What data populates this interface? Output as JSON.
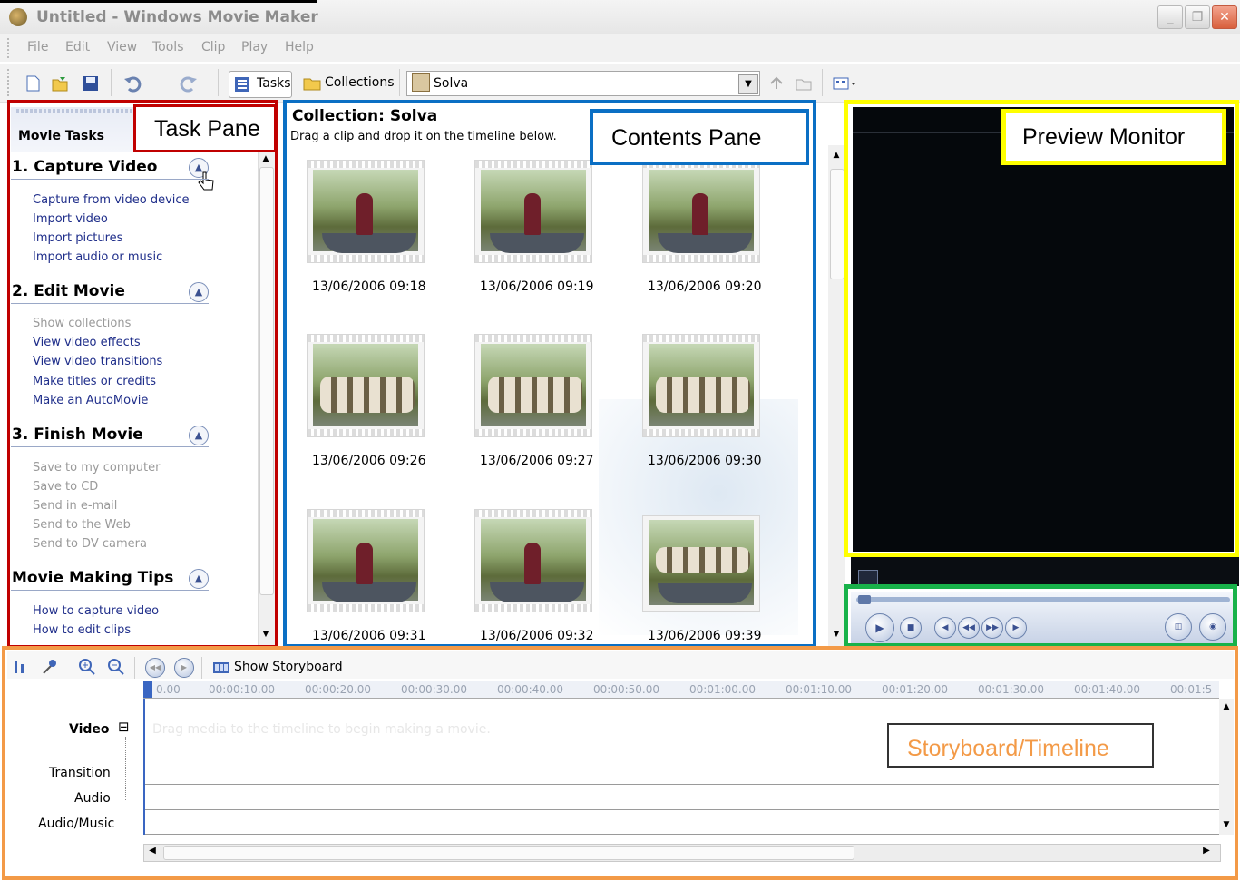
{
  "window": {
    "title": "Untitled - Windows Movie Maker",
    "minimize_glyph": "_",
    "restore_glyph": "❐",
    "close_glyph": "✕"
  },
  "menu": [
    "File",
    "Edit",
    "View",
    "Tools",
    "Clip",
    "Play",
    "Help"
  ],
  "toolbar": {
    "tasks_label": "Tasks",
    "collections_label": "Collections",
    "collection_selected": "Solva"
  },
  "annotations": {
    "task_pane": "Task Pane",
    "contents_pane": "Contents Pane",
    "preview_monitor": "Preview Monitor",
    "storyboard_timeline": "Storyboard/Timeline",
    "colors": {
      "task": "#c00000",
      "contents": "#0b6fc4",
      "preview": "#ffff00",
      "controls": "#18b24a",
      "timeline": "#f39a47"
    }
  },
  "task_pane": {
    "header": "Movie Tasks",
    "sections": [
      {
        "title": "1. Capture Video",
        "items": [
          {
            "label": "Capture from video device",
            "enabled": true
          },
          {
            "label": "Import video",
            "enabled": true
          },
          {
            "label": "Import pictures",
            "enabled": true
          },
          {
            "label": "Import audio or music",
            "enabled": true
          }
        ]
      },
      {
        "title": "2. Edit Movie",
        "items": [
          {
            "label": "Show collections",
            "enabled": false
          },
          {
            "label": "View video effects",
            "enabled": true
          },
          {
            "label": "View video transitions",
            "enabled": true
          },
          {
            "label": "Make titles or credits",
            "enabled": true
          },
          {
            "label": "Make an AutoMovie",
            "enabled": true
          }
        ]
      },
      {
        "title": "3. Finish Movie",
        "items": [
          {
            "label": "Save to my computer",
            "enabled": false
          },
          {
            "label": "Save to CD",
            "enabled": false
          },
          {
            "label": "Send in e-mail",
            "enabled": false
          },
          {
            "label": "Send to the Web",
            "enabled": false
          },
          {
            "label": "Send to DV camera",
            "enabled": false
          }
        ]
      },
      {
        "title": "Movie Making Tips",
        "items": [
          {
            "label": "How to capture video",
            "enabled": true
          },
          {
            "label": "How to edit clips",
            "enabled": true
          }
        ]
      }
    ]
  },
  "contents": {
    "title": "Collection: Solva",
    "hint": "Drag a clip and drop it on the timeline below.",
    "clips": [
      {
        "date": "13/06/2006 09:18",
        "scene": "solo"
      },
      {
        "date": "13/06/2006 09:19",
        "scene": "solo"
      },
      {
        "date": "13/06/2006 09:20",
        "scene": "solo"
      },
      {
        "date": "13/06/2006 09:26",
        "scene": "group"
      },
      {
        "date": "13/06/2006 09:27",
        "scene": "group"
      },
      {
        "date": "13/06/2006 09:30",
        "scene": "group"
      },
      {
        "date": "13/06/2006 09:31",
        "scene": "solo"
      },
      {
        "date": "13/06/2006 09:32",
        "scene": "solo"
      },
      {
        "date": "13/06/2006 09:39",
        "scene": "group"
      }
    ]
  },
  "timeline": {
    "show_storyboard": "Show Storyboard",
    "ruler": [
      "0.00",
      "00:00:10.00",
      "00:00:20.00",
      "00:00:30.00",
      "00:00:40.00",
      "00:00:50.00",
      "00:01:00.00",
      "00:01:10.00",
      "00:01:20.00",
      "00:01:30.00",
      "00:01:40.00",
      "00:01:5"
    ],
    "drag_hint": "Drag media to the timeline to begin making a movie.",
    "tracks": {
      "video": "Video",
      "video_toggle": "⊟",
      "transition": "Transition",
      "audio": "Audio",
      "audio_music": "Audio/Music"
    }
  }
}
